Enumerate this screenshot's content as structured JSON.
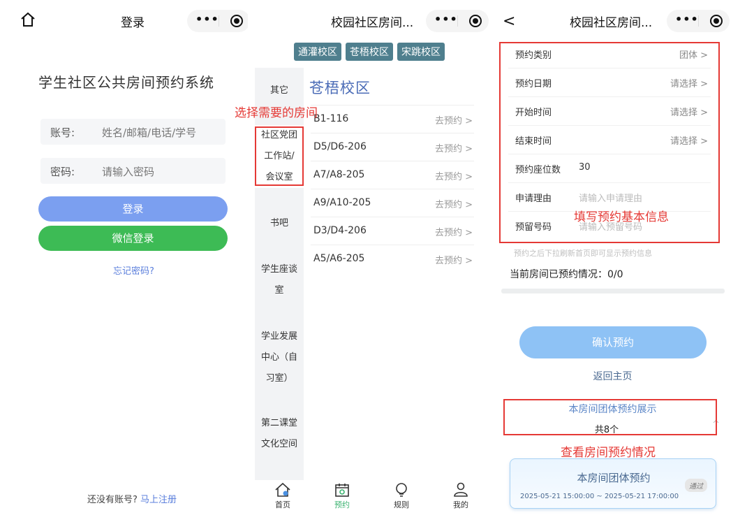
{
  "login": {
    "nav_title": "登录",
    "system_title": "学生社区公共房间预约系统",
    "account_label": "账号:",
    "account_placeholder": "姓名/邮箱/电话/学号",
    "password_label": "密码:",
    "password_placeholder": "请输入密码",
    "login_button": "登录",
    "wechat_button": "微信登录",
    "forgot_link": "忘记密码?",
    "no_account_text": "还没有账号?",
    "register_link": "马上注册",
    "colors": {
      "login_button": "#7b9ff0",
      "wechat_button": "#3dbb55"
    }
  },
  "rooms": {
    "nav_title": "校园社区房间...",
    "campus_tabs": [
      "通灌校区",
      "苍梧校区",
      "宋跳校区"
    ],
    "categories": [
      {
        "label": "其它",
        "lines": [
          "其它"
        ]
      },
      {
        "label": "社区党团工作站/会议室",
        "lines": [
          "社区党团",
          "工作站/",
          "会议室"
        ]
      },
      {
        "label": "书吧",
        "lines": [
          "书吧"
        ]
      },
      {
        "label": "学生座谈室",
        "lines": [
          "学生座谈",
          "室"
        ]
      },
      {
        "label": "学业发展中心（自习室）",
        "lines": [
          "学业发展",
          "中心（自",
          "习室）"
        ]
      },
      {
        "label": "第二课堂文化空间",
        "lines": [
          "第二课堂",
          "文化空间"
        ]
      }
    ],
    "campus_heading": "苍梧校区",
    "room_list": [
      {
        "name": "B1-116",
        "action": "去预约"
      },
      {
        "name": "D5/D6-206",
        "action": "去预约"
      },
      {
        "name": "A7/A8-205",
        "action": "去预约"
      },
      {
        "name": "A9/A10-205",
        "action": "去预约"
      },
      {
        "name": "D3/D4-206",
        "action": "去预约"
      },
      {
        "name": "A5/A6-205",
        "action": "去预约"
      }
    ],
    "tabbar": [
      {
        "label": "首页",
        "icon": "home-icon"
      },
      {
        "label": "预约",
        "icon": "calendar-icon"
      },
      {
        "label": "规则",
        "icon": "bulb-icon"
      },
      {
        "label": "我的",
        "icon": "user-icon"
      }
    ],
    "active_tab": "预约"
  },
  "booking": {
    "nav_title": "校园社区房间...",
    "rows": {
      "type_label": "预约类别",
      "type_value": "团体",
      "date_label": "预约日期",
      "date_value": "请选择",
      "start_label": "开始时间",
      "start_value": "请选择",
      "end_label": "结束时间",
      "end_value": "请选择",
      "seats_label": "预约座位数",
      "seats_value": "30",
      "reason_label": "申请理由",
      "reason_placeholder": "请输入申请理由",
      "phone_label": "预留号码",
      "phone_placeholder": "请输入预留号码"
    },
    "hint": "预约之后下拉刷新首页即可显示预约信息",
    "booked_status": "当前房间已预约情况：0/0",
    "confirm_button": "确认预约",
    "return_link": "返回主页",
    "group_title": "本房间团体预约展示",
    "group_count": "共8个",
    "card": {
      "title": "本房间团体预约",
      "time_range": "2025-05-21 15:00:00 ~ 2025-05-21 17:00:00",
      "badge": "通过"
    }
  },
  "annotations": {
    "choose_room": "选择需要的房间",
    "fill_info": "填写预约基本信息",
    "view_status": "查看房间预约情况",
    "color": "#e53935"
  }
}
